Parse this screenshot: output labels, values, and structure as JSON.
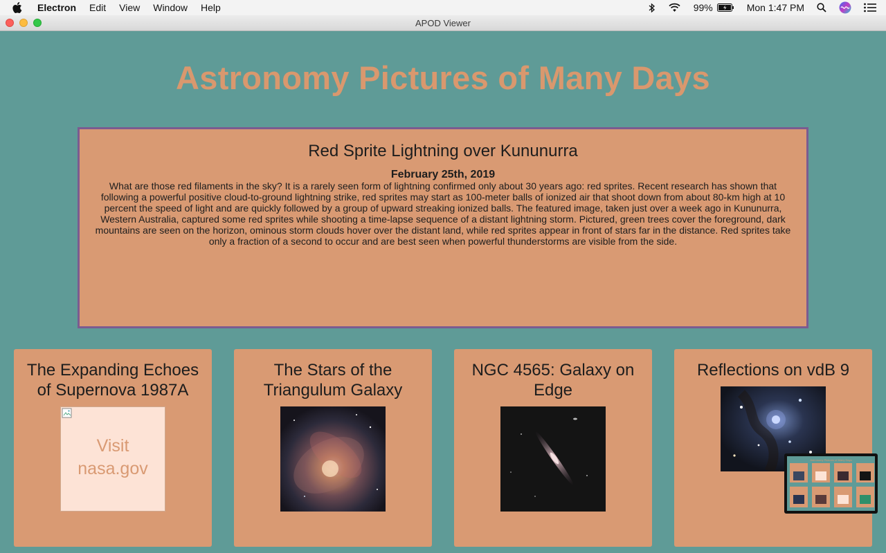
{
  "menubar": {
    "app_name": "Electron",
    "menus": [
      "Edit",
      "View",
      "Window",
      "Help"
    ],
    "battery": "99%",
    "clock": "Mon 1:47 PM"
  },
  "window": {
    "title": "APOD Viewer"
  },
  "page": {
    "title": "Astronomy Pictures of Many Days"
  },
  "feature": {
    "title": "Red Sprite Lightning over Kununurra",
    "date": "February 25th, 2019",
    "explanation": "What are those red filaments in the sky? It is a rarely seen form of lightning confirmed only about 30 years ago: red sprites. Recent research has shown that following a powerful positive cloud-to-ground lightning strike, red sprites may start as 100-meter balls of ionized air that shoot down from about 80-km high at 10 percent the speed of light and are quickly followed by a group of upward streaking ionized balls. The featured image, taken just over a week ago in Kununurra, Western Australia, captured some red sprites while shooting a time-lapse sequence of a distant lightning storm. Pictured, green trees cover the foreground, dark mountains are seen on the horizon, ominous storm clouds hover over the distant land, while red sprites appear in front of stars far in the distance. Red sprites take only a fraction of a second to occur and are best seen when powerful thunderstorms are visible from the side."
  },
  "cards": [
    {
      "title": "The Expanding Echoes of Supernova 1987A",
      "image": "broken",
      "alt_text": "Visit nasa.gov"
    },
    {
      "title": "The Stars of the Triangulum Galaxy",
      "image": "triangulum-galaxy"
    },
    {
      "title": "NGC 4565: Galaxy on Edge",
      "image": "edge-on-galaxy"
    },
    {
      "title": "Reflections on vdB 9",
      "image": "reflection-nebula"
    }
  ],
  "colors": {
    "background": "#5f9b97",
    "accent": "#d9986e",
    "card": "#d99a73",
    "feature_border": "#7b5b90"
  }
}
